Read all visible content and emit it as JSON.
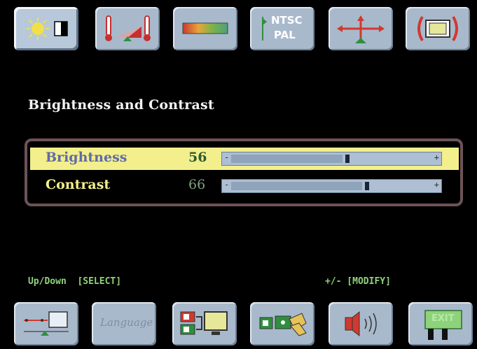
{
  "tabs": [
    {
      "name": "brightness-contrast-tab",
      "icon": "sun-contrast-icon"
    },
    {
      "name": "color-temperature-tab",
      "icon": "thermometer-icon"
    },
    {
      "name": "color-bar-tab",
      "icon": "color-bar-icon"
    },
    {
      "name": "video-standard-tab",
      "icon": "ntsc-pal-icon",
      "label_top": "NTSC",
      "label_bottom": "PAL"
    },
    {
      "name": "position-tab",
      "icon": "position-arrows-icon"
    },
    {
      "name": "size-tab",
      "icon": "screen-size-icon"
    }
  ],
  "section_title": "Brightness and Contrast",
  "controls": {
    "brightness": {
      "label": "Brightness",
      "value": "56",
      "level": 0.56
    },
    "contrast": {
      "label": "Contrast",
      "value": "66",
      "level": 0.66
    }
  },
  "slider_symbols": {
    "minus": "-",
    "plus": "+"
  },
  "hints": {
    "select": "Up/Down  [SELECT]",
    "modify": "+/- [MODIFY]"
  },
  "bottom_buttons": [
    {
      "name": "input-setup-button",
      "icon": "input-monitor-icon"
    },
    {
      "name": "language-button",
      "icon": "language-icon",
      "label": "Language"
    },
    {
      "name": "input-select-button",
      "icon": "input-source-icon"
    },
    {
      "name": "tools-button",
      "icon": "wrench-icon"
    },
    {
      "name": "volume-button",
      "icon": "speaker-icon"
    },
    {
      "name": "exit-button",
      "icon": "exit-icon",
      "label": "EXIT"
    }
  ],
  "colors": {
    "selected_row": "#f3ef8c",
    "brightness_label": "#5f6aa8",
    "brightness_value": "#2f5b2f",
    "contrast_label": "#f3ef8c",
    "contrast_value": "#7fa07f",
    "hint": "#8ed37b"
  }
}
